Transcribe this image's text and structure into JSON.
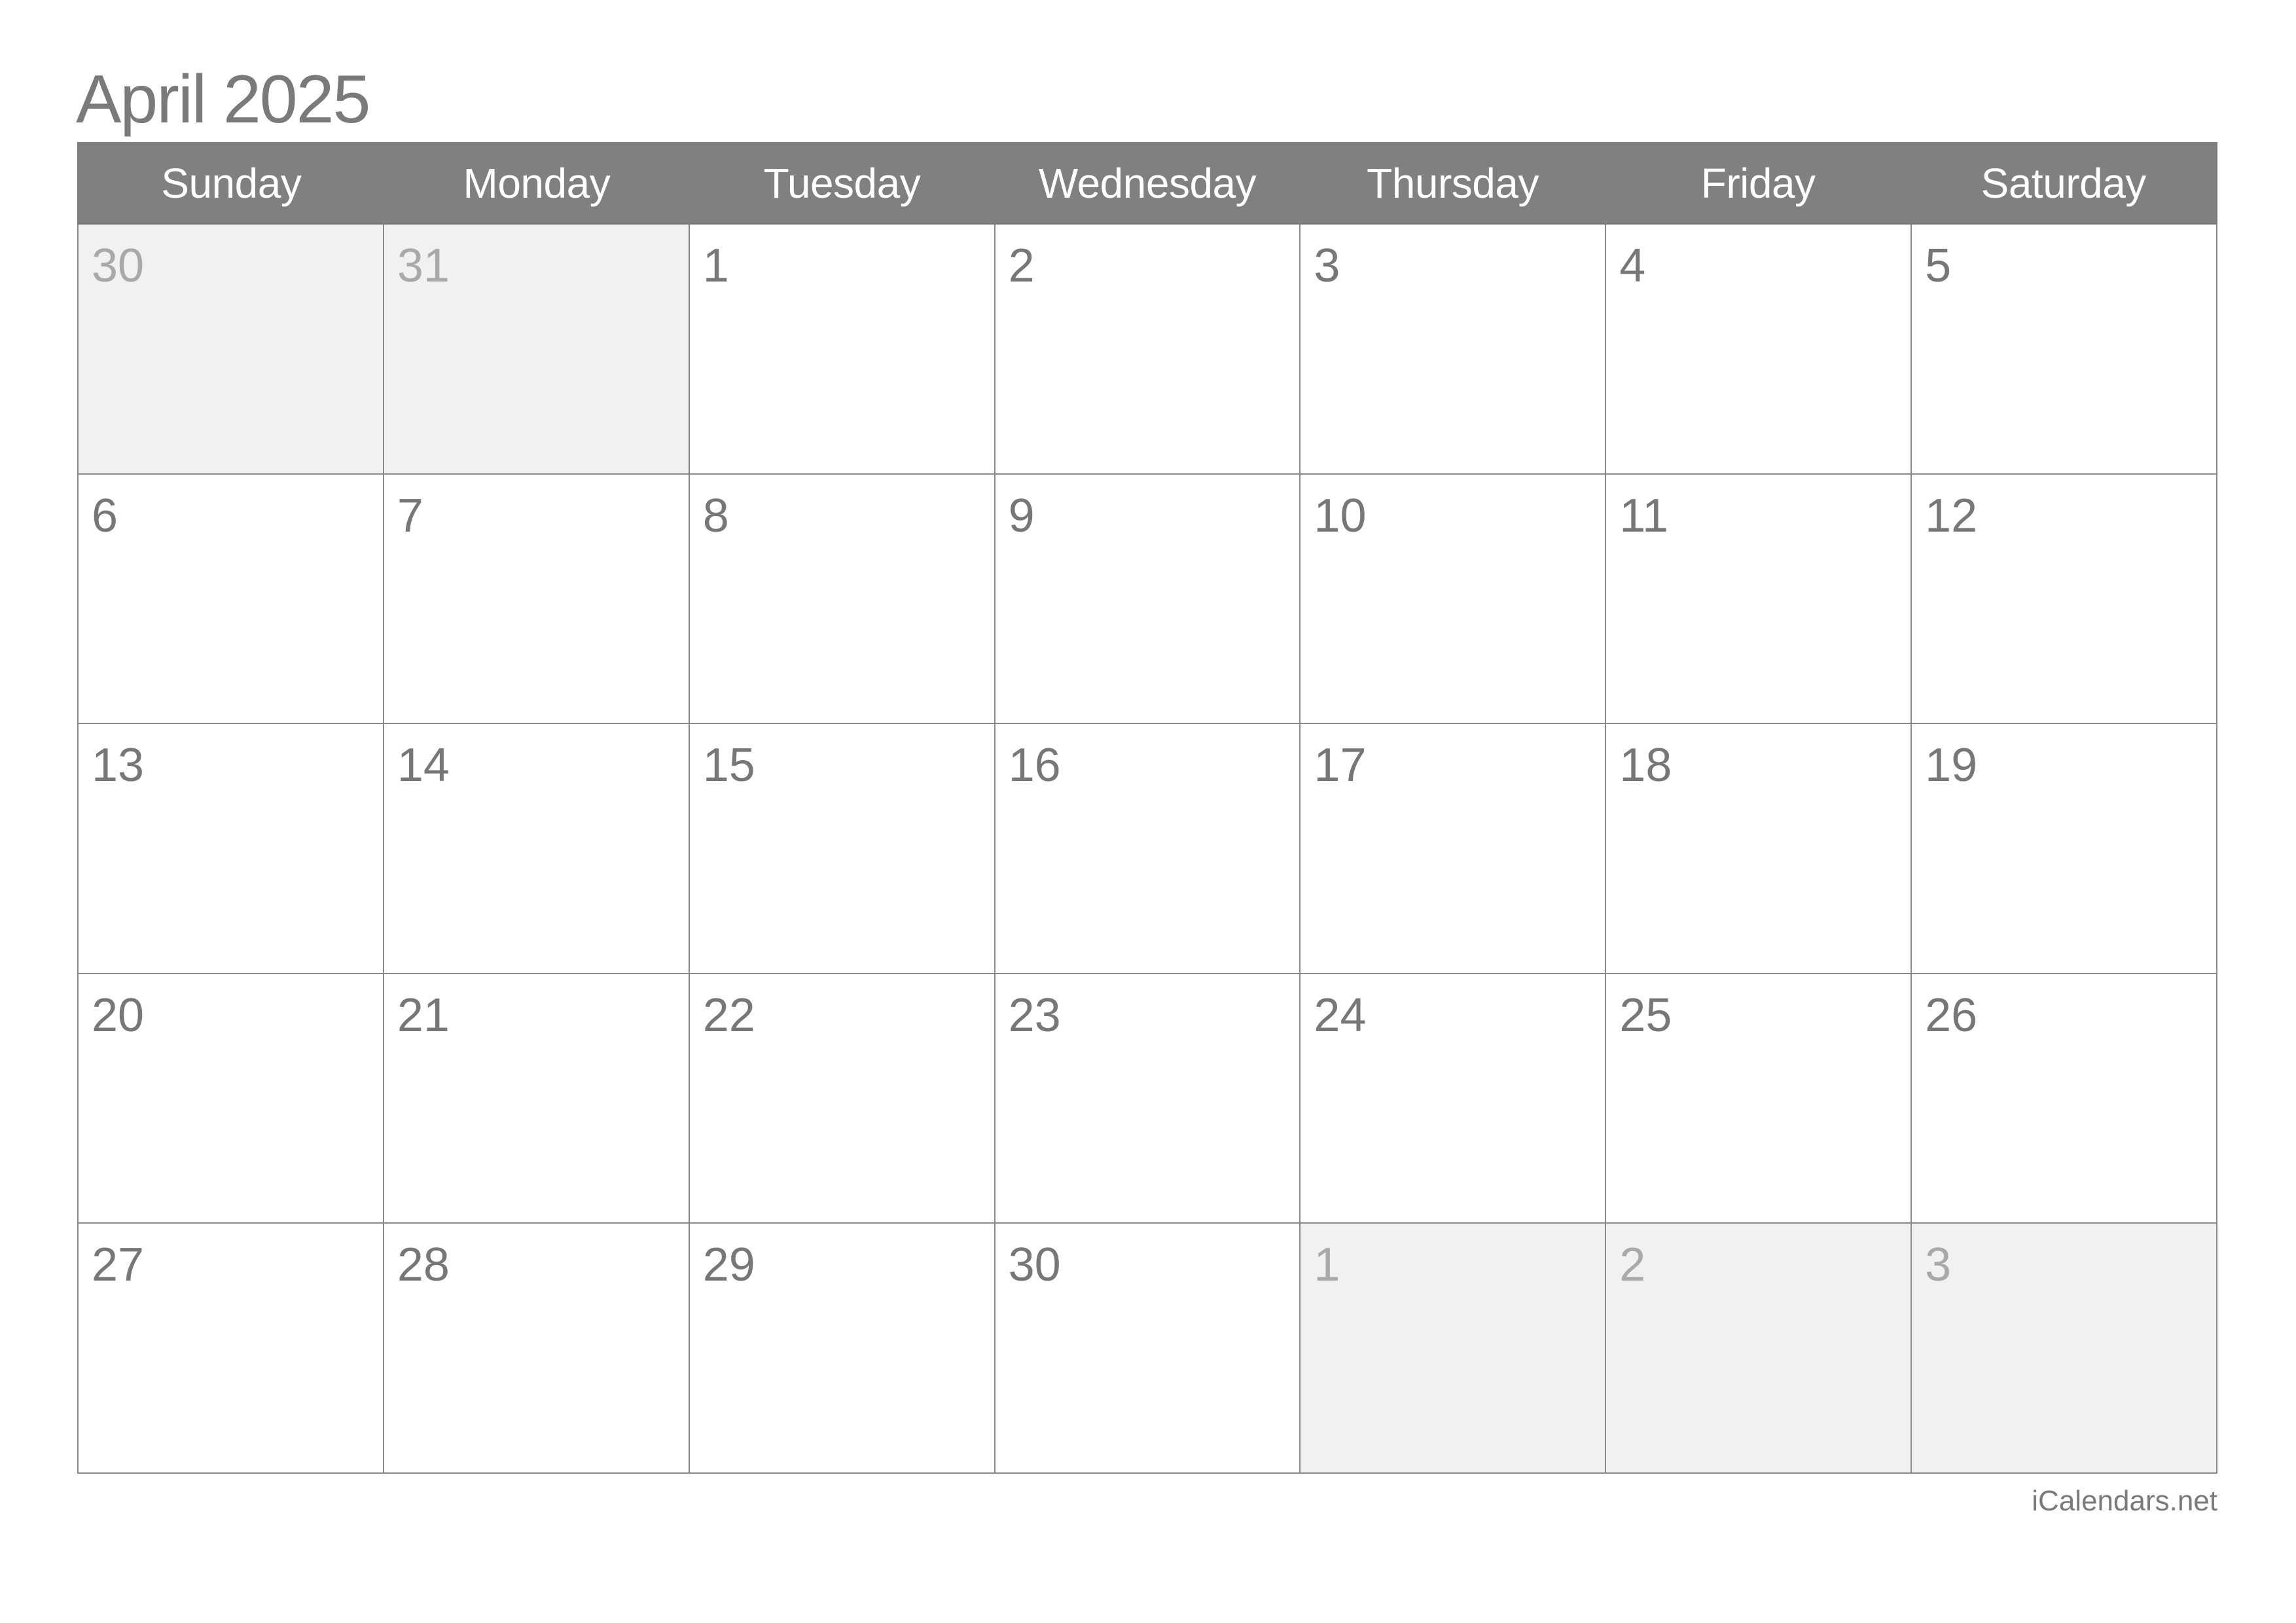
{
  "title": "April 2025",
  "weekdays": [
    "Sunday",
    "Monday",
    "Tuesday",
    "Wednesday",
    "Thursday",
    "Friday",
    "Saturday"
  ],
  "weeks": [
    [
      {
        "day": "30",
        "other": true
      },
      {
        "day": "31",
        "other": true
      },
      {
        "day": "1"
      },
      {
        "day": "2"
      },
      {
        "day": "3"
      },
      {
        "day": "4"
      },
      {
        "day": "5"
      }
    ],
    [
      {
        "day": "6"
      },
      {
        "day": "7"
      },
      {
        "day": "8"
      },
      {
        "day": "9"
      },
      {
        "day": "10"
      },
      {
        "day": "11"
      },
      {
        "day": "12"
      }
    ],
    [
      {
        "day": "13"
      },
      {
        "day": "14"
      },
      {
        "day": "15"
      },
      {
        "day": "16"
      },
      {
        "day": "17"
      },
      {
        "day": "18"
      },
      {
        "day": "19"
      }
    ],
    [
      {
        "day": "20"
      },
      {
        "day": "21"
      },
      {
        "day": "22"
      },
      {
        "day": "23"
      },
      {
        "day": "24"
      },
      {
        "day": "25"
      },
      {
        "day": "26"
      }
    ],
    [
      {
        "day": "27"
      },
      {
        "day": "28"
      },
      {
        "day": "29"
      },
      {
        "day": "30"
      },
      {
        "day": "1",
        "other": true
      },
      {
        "day": "2",
        "other": true
      },
      {
        "day": "3",
        "other": true
      }
    ]
  ],
  "footer": "iCalendars.net",
  "colors": {
    "header_bg": "#808080",
    "header_text": "#ffffff",
    "day_text": "#777777",
    "other_month_bg": "#f1f1f1",
    "other_month_text": "#a9a9a9",
    "grid_line": "#8a8a8a"
  }
}
